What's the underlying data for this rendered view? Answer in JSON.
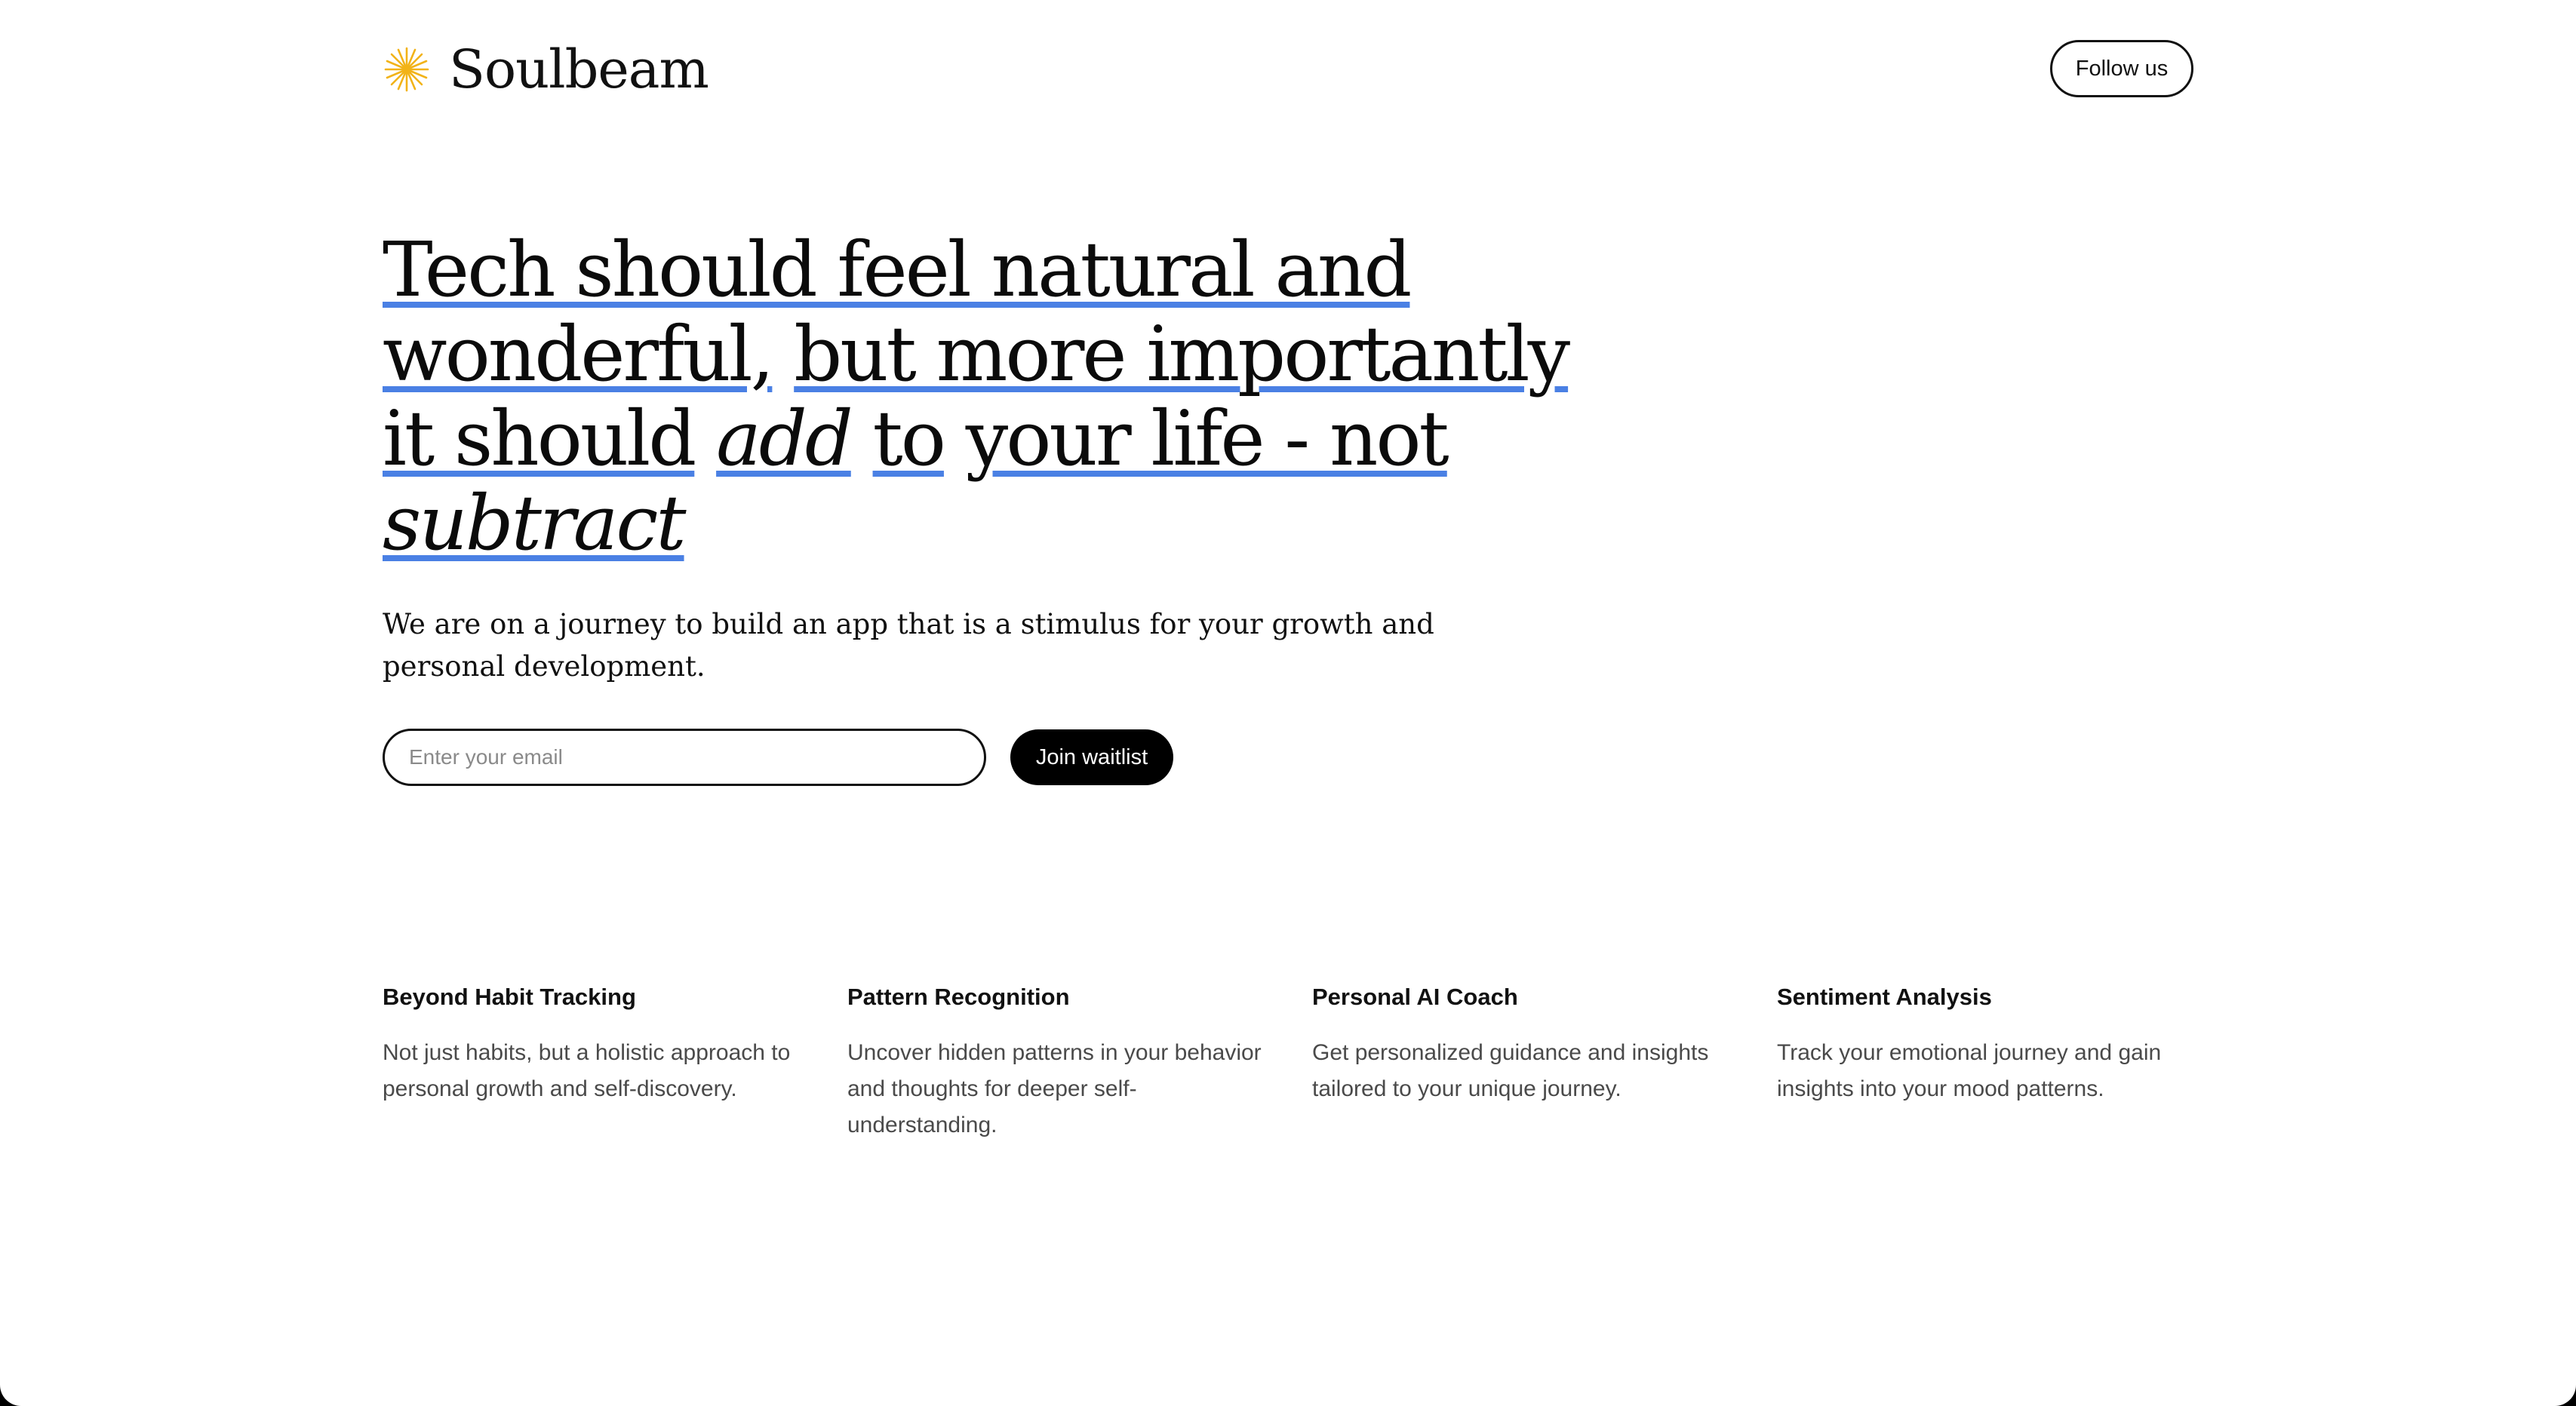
{
  "brand": {
    "name": "Soulbeam",
    "logo_icon": "sparkle-star-icon",
    "accent_color": "#f2b318",
    "underline_color": "#4a80e4"
  },
  "header": {
    "follow_label": "Follow us"
  },
  "hero": {
    "title_parts": [
      "Tech should feel natural and",
      "wonderful,",
      "but more importantly",
      "it should",
      "add",
      "to",
      "your life - not",
      "subtract"
    ],
    "subtitle": "We are on a journey to build an app that is a stimulus for your growth and personal development."
  },
  "waitlist": {
    "email_placeholder": "Enter your email",
    "email_value": "",
    "join_label": "Join waitlist"
  },
  "features": [
    {
      "title": "Beyond Habit Tracking",
      "description": "Not just habits, but a holistic approach to personal growth and self-discovery."
    },
    {
      "title": "Pattern Recognition",
      "description": "Uncover hidden patterns in your behavior and thoughts for deeper self-understanding."
    },
    {
      "title": "Personal AI Coach",
      "description": "Get personalized guidance and insights tailored to your unique journey."
    },
    {
      "title": "Sentiment Analysis",
      "description": "Track your emotional journey and gain insights into your mood patterns."
    }
  ]
}
